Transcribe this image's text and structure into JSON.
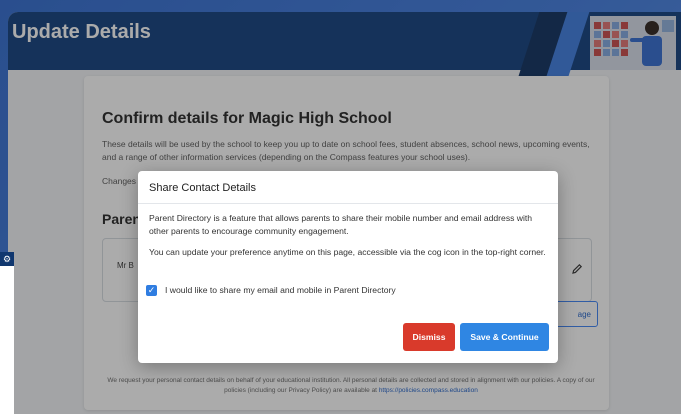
{
  "header": {
    "title": "Update Details"
  },
  "card": {
    "title": "Confirm details for Magic High School",
    "description": "These details will be used by the school to keep you up to date on school fees, student absences, school news, upcoming events, and a range of other information services (depending on the Compass features your school uses).",
    "changes_label": "Changes",
    "section_title": "Parent",
    "person_name": "Mr B",
    "bg_button_label": "age",
    "footer_text": "We request your personal contact details on behalf of your educational institution. All personal details are collected and stored in alignment with our policies. A copy of our policies (including our Privacy Policy) are available at ",
    "footer_link": "https://policies.compass.education"
  },
  "modal": {
    "title": "Share Contact Details",
    "paragraph1": "Parent Directory is a feature that allows parents to share their mobile number and email address with other parents to encourage community engagement.",
    "paragraph2": "You can update your preference anytime on this page, accessible via the cog icon in the top-right corner.",
    "checkbox_label": "I would like to share my email and mobile in Parent Directory",
    "checkbox_checked": true,
    "dismiss_label": "Dismiss",
    "save_label": "Save & Continue"
  },
  "icons": {
    "edit": "pencil-icon",
    "settings": "cog-icon",
    "check": "checkmark-icon"
  },
  "colors": {
    "header_bg": "#0e3c7c",
    "dismiss_bg": "#d93a2b",
    "save_bg": "#2f86e3",
    "checkbox_bg": "#2f7de1",
    "link": "#1d5fc8"
  }
}
